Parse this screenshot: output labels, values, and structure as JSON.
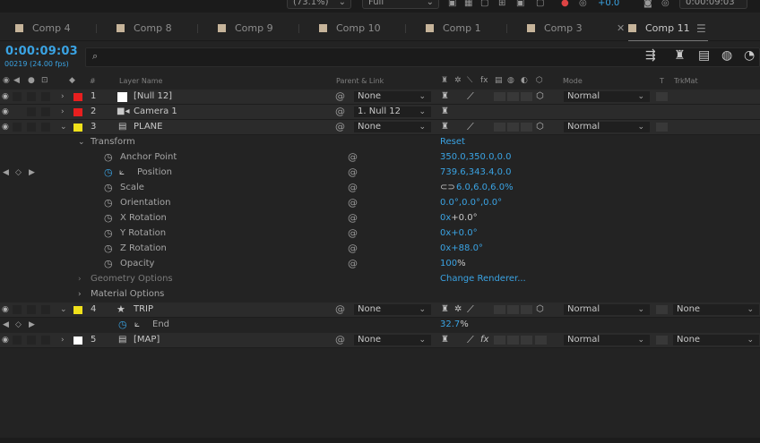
{
  "topbar": {
    "zoom": "(73.1%)",
    "quality": "Full",
    "exposure": "+0.0",
    "timecode": "0:00:09:03"
  },
  "tabs": [
    {
      "label": "Comp 4"
    },
    {
      "label": "Comp 8"
    },
    {
      "label": "Comp 9"
    },
    {
      "label": "Comp 10"
    },
    {
      "label": "Comp 1"
    },
    {
      "label": "Comp 3"
    },
    {
      "label": "Comp 11",
      "active": true
    }
  ],
  "timeline": {
    "timecode": "0:00:09:03",
    "frames": "00219 (24.00 fps)",
    "search_placeholder": ""
  },
  "columns": {
    "num": "#",
    "layer_name": "Layer Name",
    "parent": "Parent & Link",
    "mode": "Mode",
    "t": "T",
    "trkmat": "TrkMat"
  },
  "layers": [
    {
      "num": "1",
      "name": "[Null 12]",
      "label_color": "#e81f1f",
      "parent": "None",
      "mode": "Normal"
    },
    {
      "num": "2",
      "name": "Camera 1",
      "label_color": "#e81f1f",
      "parent": "1. Null 12"
    },
    {
      "num": "3",
      "name": "PLANE",
      "label_color": "#f0e11b",
      "parent": "None",
      "mode": "Normal"
    },
    {
      "num": "4",
      "name": "TRIP",
      "label_color": "#f0e11b",
      "parent": "None",
      "mode": "Normal",
      "trkmat": "None"
    },
    {
      "num": "5",
      "name": "[MAP]",
      "label_color": "#ffffff",
      "parent": "None",
      "mode": "Normal",
      "trkmat": "None"
    }
  ],
  "transform": {
    "group": "Transform",
    "reset": "Reset",
    "anchor": {
      "label": "Anchor Point",
      "value": "350.0,350.0,0.0"
    },
    "position": {
      "label": "Position",
      "value": "739.6,343.4,0.0"
    },
    "scale": {
      "label": "Scale",
      "value": "6.0,6.0,6.0%"
    },
    "orientation": {
      "label": "Orientation",
      "value": "0.0°,0.0°,0.0°"
    },
    "xrot": {
      "label": "X Rotation",
      "turns": "0x",
      "deg": "+0.0°"
    },
    "yrot": {
      "label": "Y Rotation",
      "value": "0x+0.0°"
    },
    "zrot": {
      "label": "Z Rotation",
      "value": "0x+88.0°"
    },
    "opacity": {
      "label": "Opacity",
      "value": "100",
      "unit": "%"
    }
  },
  "geometry": {
    "label": "Geometry Options",
    "action": "Change Renderer..."
  },
  "material": {
    "label": "Material Options"
  },
  "trip_end": {
    "label": "End",
    "value": "32.7",
    "unit": "%"
  },
  "accent": "#3aa3e3"
}
